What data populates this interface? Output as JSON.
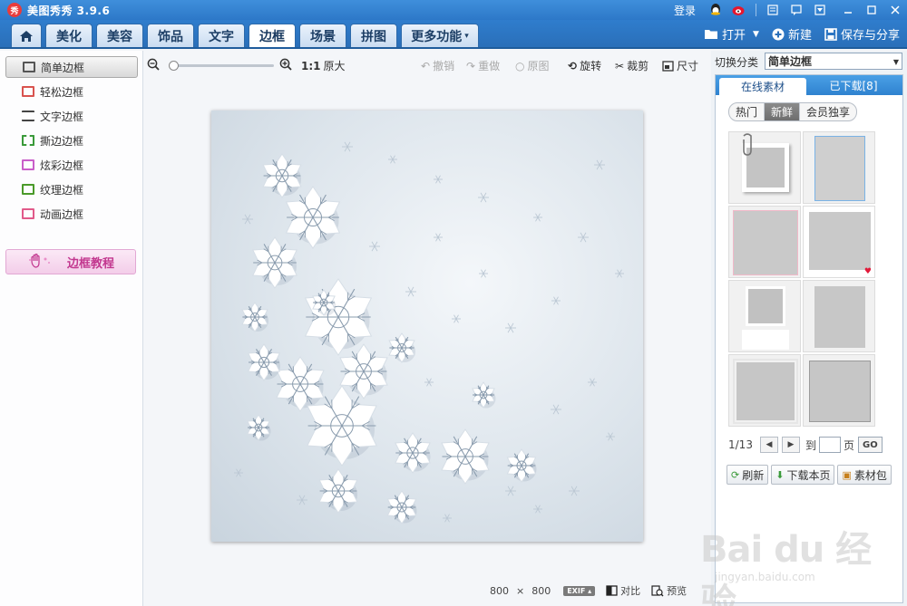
{
  "window": {
    "app_logo": "秀",
    "title": "美图秀秀 3.9.6",
    "login": "登录"
  },
  "nav": {
    "tabs": [
      "美化",
      "美容",
      "饰品",
      "文字",
      "边框",
      "场景",
      "拼图",
      "更多功能"
    ],
    "active_tab": "边框",
    "more_suffix": "▾",
    "open": "打开",
    "new": "新建",
    "save_share": "保存与分享"
  },
  "left": {
    "items": [
      "简单边框",
      "轻松边框",
      "文字边框",
      "撕边边框",
      "炫彩边框",
      "纹理边框",
      "动画边框"
    ],
    "active_item": "简单边框",
    "tutorial": "边框教程"
  },
  "toolbar": {
    "ratio": "1:1",
    "original_size": "原大",
    "undo": "撤销",
    "redo": "重做",
    "original": "原图",
    "rotate": "旋转",
    "crop": "裁剪",
    "size": "尺寸",
    "zoom_level": 0.0
  },
  "status": {
    "width": "800",
    "times": "×",
    "height": "800",
    "exif": "EXIF",
    "compare": "对比",
    "preview": "预览"
  },
  "right": {
    "category_label": "切换分类",
    "category_value": "简单边框",
    "tab_online": "在线素材",
    "tab_downloaded": "已下载[8]",
    "seg": [
      "热门",
      "新鲜",
      "会员独享"
    ],
    "seg_active": "新鲜",
    "page": "1/13",
    "to": "到",
    "page_unit": "页",
    "go": "GO",
    "refresh": "刷新",
    "download_page": "下载本页",
    "material_pack": "素材包"
  },
  "watermark": {
    "main": "Bai du 经验",
    "sub": "jingyan.baidu.com"
  },
  "colors": {
    "titlebar": "#2d78c8",
    "accent": "#2f82cf",
    "tutorial": "#c2378f"
  }
}
